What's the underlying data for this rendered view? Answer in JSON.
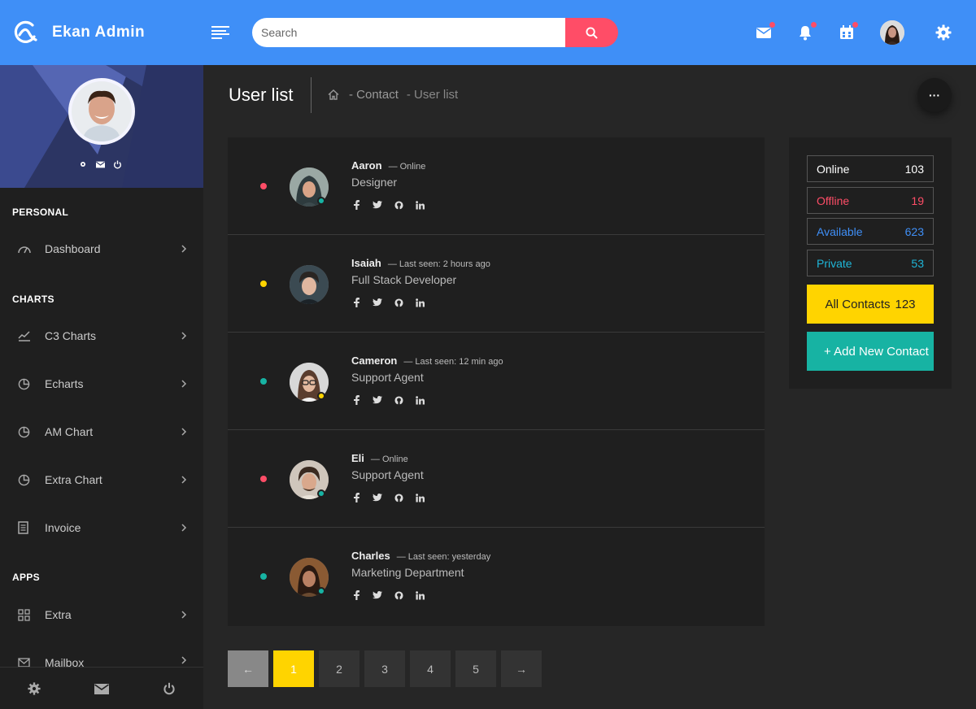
{
  "brand": {
    "name": "Ekan Admin"
  },
  "search": {
    "placeholder": "Search"
  },
  "sidebar": {
    "sections": [
      "PERSONAL",
      "CHARTS",
      "APPS"
    ],
    "items": [
      {
        "label": "Dashboard",
        "icon": "dashboard-icon"
      },
      {
        "label": "C3 Charts",
        "icon": "line-chart-icon"
      },
      {
        "label": "Echarts",
        "icon": "pie-chart-icon"
      },
      {
        "label": "AM Chart",
        "icon": "pie-chart-icon"
      },
      {
        "label": "Extra Chart",
        "icon": "pie-chart-icon"
      },
      {
        "label": "Invoice",
        "icon": "invoice-icon"
      },
      {
        "label": "Extra",
        "icon": "grid-icon"
      },
      {
        "label": "Mailbox",
        "icon": "mail-icon"
      }
    ]
  },
  "page": {
    "title": "User list",
    "breadcrumb": [
      "- Contact",
      "- User list"
    ]
  },
  "users": [
    {
      "name": "Aaron",
      "status": "— Online",
      "role": "Designer",
      "dot_color": "#ff4d67",
      "avatar_dot": "#17b3a3"
    },
    {
      "name": "Isaiah",
      "status": "— Last seen: 2 hours ago",
      "role": "Full Stack Developer",
      "dot_color": "#ffd400",
      "avatar_dot": ""
    },
    {
      "name": "Cameron",
      "status": "— Last seen: 12 min ago",
      "role": "Support Agent",
      "dot_color": "#17b3a3",
      "avatar_dot": "#ffd400"
    },
    {
      "name": "Eli",
      "status": "— Online",
      "role": "Support Agent",
      "dot_color": "#ff4d67",
      "avatar_dot": "#17b3a3"
    },
    {
      "name": "Charles",
      "status": "— Last seen: yesterday",
      "role": "Marketing Department",
      "dot_color": "#17b3a3",
      "avatar_dot": "#17b3a3"
    }
  ],
  "stats": [
    {
      "label": "Online",
      "value": "103",
      "color": "#ffffff"
    },
    {
      "label": "Offline",
      "value": "19",
      "color": "#ff4d67"
    },
    {
      "label": "Available",
      "value": "623",
      "color": "#3f8ff7"
    },
    {
      "label": "Private",
      "value": "53",
      "color": "#1fb6d8"
    }
  ],
  "all_contacts": {
    "label": "All Contacts",
    "value": "123"
  },
  "add_contact": {
    "label": "+ Add New Contact"
  },
  "pagination": {
    "prev": "←",
    "pages": [
      "1",
      "2",
      "3",
      "4",
      "5"
    ],
    "next": "→",
    "active": "1"
  },
  "colors": {
    "topbar": "#3f8ff7",
    "accent_red": "#ff4d67",
    "accent_yellow": "#ffd400",
    "accent_teal": "#17b3a3"
  }
}
